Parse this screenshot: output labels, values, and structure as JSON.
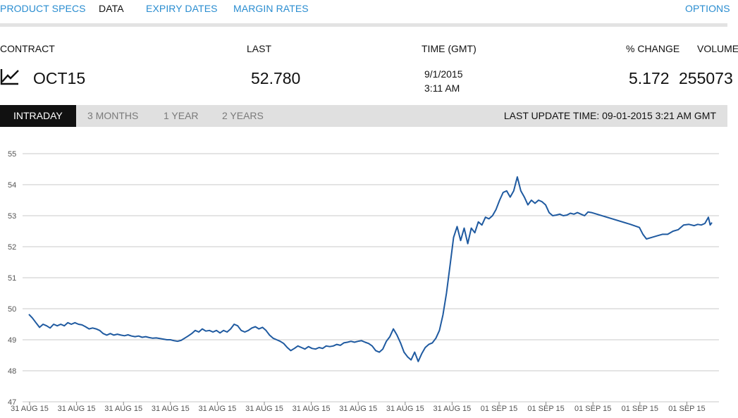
{
  "nav": {
    "items": [
      "PRODUCT SPECS",
      "DATA",
      "EXPIRY DATES",
      "MARGIN RATES"
    ],
    "active": 1,
    "options": "OPTIONS"
  },
  "quote": {
    "headers": {
      "contract": "CONTRACT",
      "last": "LAST",
      "time": "TIME (GMT)",
      "pct_change": "% CHANGE",
      "volume": "VOLUME"
    },
    "contract": "OCT15",
    "last": "52.780",
    "date": "9/1/2015",
    "time": "3:11 AM",
    "pct_change": "5.172",
    "volume": "255073",
    "icon": "line-chart-icon"
  },
  "tabs": {
    "items": [
      "INTRADAY",
      "3 MONTHS",
      "1 YEAR",
      "2 YEARS"
    ],
    "active": 0,
    "last_update": "LAST UPDATE TIME: 09-01-2015 3:21 AM GMT"
  },
  "chart_data": {
    "type": "line",
    "ylim": [
      47,
      55
    ],
    "yticks": [
      47,
      48,
      49,
      50,
      51,
      52,
      53,
      54,
      55
    ],
    "xticks": [
      "31 AUG 15",
      "31 AUG 15",
      "31 AUG 15",
      "31 AUG 15",
      "31 AUG 15",
      "31 AUG 15",
      "31 AUG 15",
      "31 AUG 15",
      "31 AUG 15",
      "31 AUG 15",
      "01 SEP 15",
      "01 SEP 15",
      "01 SEP 15",
      "01 SEP 15",
      "01 SEP 15"
    ],
    "grid": true,
    "line_color": "#1f5aa0",
    "series": [
      {
        "values": [
          [
            0,
            49.82
          ],
          [
            2,
            49.7
          ],
          [
            4,
            49.55
          ],
          [
            6,
            49.4
          ],
          [
            8,
            49.5
          ],
          [
            10,
            49.45
          ],
          [
            12,
            49.38
          ],
          [
            14,
            49.5
          ],
          [
            16,
            49.45
          ],
          [
            18,
            49.5
          ],
          [
            20,
            49.45
          ],
          [
            22,
            49.55
          ],
          [
            24,
            49.5
          ],
          [
            26,
            49.55
          ],
          [
            28,
            49.5
          ],
          [
            30,
            49.48
          ],
          [
            32,
            49.42
          ],
          [
            34,
            49.35
          ],
          [
            36,
            49.38
          ],
          [
            38,
            49.35
          ],
          [
            40,
            49.3
          ],
          [
            42,
            49.2
          ],
          [
            44,
            49.15
          ],
          [
            46,
            49.2
          ],
          [
            48,
            49.15
          ],
          [
            50,
            49.18
          ],
          [
            52,
            49.15
          ],
          [
            54,
            49.13
          ],
          [
            56,
            49.16
          ],
          [
            58,
            49.12
          ],
          [
            60,
            49.1
          ],
          [
            62,
            49.12
          ],
          [
            64,
            49.08
          ],
          [
            66,
            49.1
          ],
          [
            68,
            49.07
          ],
          [
            70,
            49.05
          ],
          [
            72,
            49.06
          ],
          [
            74,
            49.04
          ],
          [
            76,
            49.02
          ],
          [
            78,
            49.0
          ],
          [
            80,
            49.0
          ],
          [
            82,
            48.97
          ],
          [
            84,
            48.95
          ],
          [
            86,
            48.98
          ],
          [
            88,
            49.05
          ],
          [
            90,
            49.12
          ],
          [
            92,
            49.2
          ],
          [
            94,
            49.3
          ],
          [
            96,
            49.25
          ],
          [
            98,
            49.35
          ],
          [
            100,
            49.28
          ],
          [
            102,
            49.3
          ],
          [
            104,
            49.25
          ],
          [
            106,
            49.3
          ],
          [
            108,
            49.22
          ],
          [
            110,
            49.3
          ],
          [
            112,
            49.25
          ],
          [
            114,
            49.35
          ],
          [
            116,
            49.5
          ],
          [
            118,
            49.45
          ],
          [
            120,
            49.3
          ],
          [
            122,
            49.25
          ],
          [
            124,
            49.3
          ],
          [
            126,
            49.38
          ],
          [
            128,
            49.42
          ],
          [
            130,
            49.35
          ],
          [
            132,
            49.4
          ],
          [
            134,
            49.3
          ],
          [
            136,
            49.15
          ],
          [
            138,
            49.05
          ],
          [
            140,
            49.0
          ],
          [
            142,
            48.95
          ],
          [
            144,
            48.88
          ],
          [
            146,
            48.75
          ],
          [
            148,
            48.65
          ],
          [
            150,
            48.72
          ],
          [
            152,
            48.8
          ],
          [
            154,
            48.75
          ],
          [
            156,
            48.7
          ],
          [
            158,
            48.78
          ],
          [
            160,
            48.72
          ],
          [
            162,
            48.7
          ],
          [
            164,
            48.75
          ],
          [
            166,
            48.72
          ],
          [
            168,
            48.8
          ],
          [
            170,
            48.78
          ],
          [
            172,
            48.8
          ],
          [
            174,
            48.85
          ],
          [
            176,
            48.82
          ],
          [
            178,
            48.9
          ],
          [
            180,
            48.92
          ],
          [
            182,
            48.95
          ],
          [
            184,
            48.92
          ],
          [
            186,
            48.95
          ],
          [
            188,
            48.97
          ],
          [
            190,
            48.92
          ],
          [
            192,
            48.88
          ],
          [
            194,
            48.8
          ],
          [
            196,
            48.65
          ],
          [
            198,
            48.6
          ],
          [
            200,
            48.7
          ],
          [
            202,
            48.95
          ],
          [
            204,
            49.1
          ],
          [
            206,
            49.35
          ],
          [
            208,
            49.15
          ],
          [
            210,
            48.9
          ],
          [
            212,
            48.6
          ],
          [
            214,
            48.45
          ],
          [
            216,
            48.35
          ],
          [
            218,
            48.6
          ],
          [
            220,
            48.3
          ],
          [
            222,
            48.55
          ],
          [
            224,
            48.75
          ],
          [
            226,
            48.85
          ],
          [
            228,
            48.9
          ],
          [
            230,
            49.05
          ],
          [
            232,
            49.3
          ],
          [
            234,
            49.8
          ],
          [
            236,
            50.5
          ],
          [
            238,
            51.4
          ],
          [
            240,
            52.3
          ],
          [
            242,
            52.65
          ],
          [
            244,
            52.2
          ],
          [
            246,
            52.6
          ],
          [
            248,
            52.1
          ],
          [
            250,
            52.6
          ],
          [
            252,
            52.45
          ],
          [
            254,
            52.8
          ],
          [
            256,
            52.7
          ],
          [
            258,
            52.95
          ],
          [
            260,
            52.9
          ],
          [
            262,
            53.0
          ],
          [
            264,
            53.2
          ],
          [
            266,
            53.5
          ],
          [
            268,
            53.75
          ],
          [
            270,
            53.8
          ],
          [
            272,
            53.6
          ],
          [
            274,
            53.8
          ],
          [
            276,
            54.25
          ],
          [
            278,
            53.8
          ],
          [
            280,
            53.6
          ],
          [
            282,
            53.35
          ],
          [
            284,
            53.5
          ],
          [
            286,
            53.4
          ],
          [
            288,
            53.5
          ],
          [
            290,
            53.45
          ],
          [
            292,
            53.35
          ],
          [
            294,
            53.1
          ],
          [
            296,
            53.0
          ],
          [
            298,
            53.02
          ],
          [
            300,
            53.05
          ],
          [
            302,
            53.0
          ],
          [
            304,
            53.02
          ],
          [
            306,
            53.08
          ],
          [
            308,
            53.05
          ],
          [
            310,
            53.1
          ],
          [
            312,
            53.05
          ],
          [
            314,
            53.0
          ],
          [
            316,
            53.12
          ],
          [
            318,
            53.1
          ],
          [
            340,
            52.72
          ],
          [
            345,
            52.62
          ],
          [
            347,
            52.4
          ],
          [
            349,
            52.25
          ],
          [
            352,
            52.3
          ],
          [
            355,
            52.35
          ],
          [
            358,
            52.4
          ],
          [
            361,
            52.4
          ],
          [
            364,
            52.5
          ],
          [
            367,
            52.55
          ],
          [
            370,
            52.7
          ],
          [
            373,
            52.72
          ],
          [
            376,
            52.68
          ],
          [
            378,
            52.72
          ],
          [
            380,
            52.7
          ],
          [
            382,
            52.75
          ],
          [
            384,
            52.95
          ],
          [
            385,
            52.7
          ],
          [
            386,
            52.78
          ]
        ]
      }
    ]
  }
}
